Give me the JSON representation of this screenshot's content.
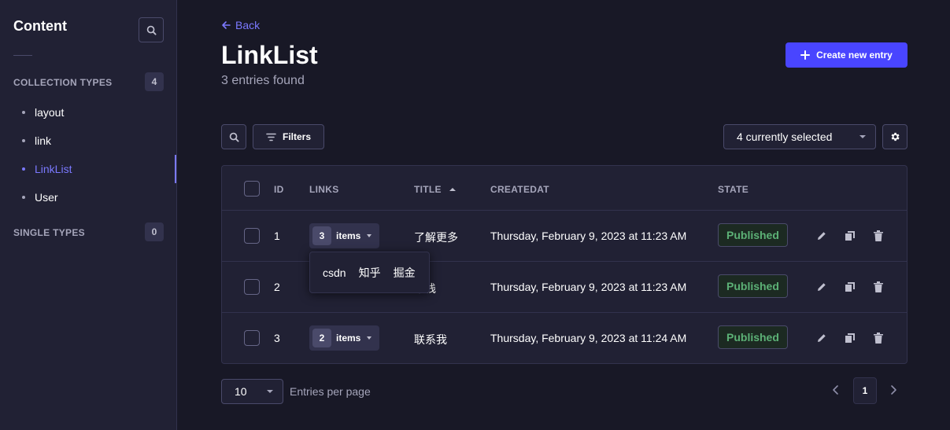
{
  "sidebar": {
    "title": "Content",
    "collection_types": {
      "label": "COLLECTION TYPES",
      "count": "4",
      "items": [
        {
          "label": "layout"
        },
        {
          "label": "link"
        },
        {
          "label": "LinkList"
        },
        {
          "label": "User"
        }
      ]
    },
    "single_types": {
      "label": "SINGLE TYPES",
      "count": "0"
    },
    "active_item": "LinkList"
  },
  "header": {
    "back_label": "Back",
    "title": "LinkList",
    "subtitle": "3 entries found",
    "create_label": "Create new entry"
  },
  "toolbar": {
    "filters_label": "Filters",
    "columns_select": "4 currently selected"
  },
  "table": {
    "headers": {
      "id": "ID",
      "links": "LINKS",
      "title": "TITLE",
      "createdat": "CREATEDAT",
      "state": "STATE"
    },
    "sort": {
      "column": "TITLE",
      "direction": "asc"
    },
    "rows": [
      {
        "id": "1",
        "links_count": "3",
        "links_label": "items",
        "title": "了解更多",
        "createdat": "Thursday, February 9, 2023 at 11:23 AM",
        "state": "Published"
      },
      {
        "id": "2",
        "links_count": "",
        "links_label": "",
        "title": "术栈",
        "createdat": "Thursday, February 9, 2023 at 11:23 AM",
        "state": "Published"
      },
      {
        "id": "3",
        "links_count": "2",
        "links_label": "items",
        "title": "联系我",
        "createdat": "Thursday, February 9, 2023 at 11:24 AM",
        "state": "Published"
      }
    ]
  },
  "popover": {
    "items": [
      "csdn",
      "知乎",
      "掘金"
    ]
  },
  "pagination": {
    "per_page": "10",
    "per_page_label": "Entries per page",
    "current_page": "1"
  },
  "colors": {
    "primary": "#4945ff",
    "accent": "#7b79ff",
    "published": "#5cb176",
    "background": "#181826",
    "panel": "#212134"
  }
}
